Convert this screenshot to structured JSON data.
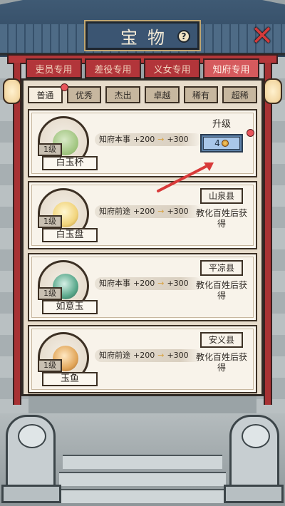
{
  "title": "宝物",
  "top_tabs": [
    {
      "label": "吏员专用",
      "active": false
    },
    {
      "label": "差役专用",
      "active": false
    },
    {
      "label": "义女专用",
      "active": false
    },
    {
      "label": "知府专用",
      "active": true
    }
  ],
  "sub_tabs": [
    {
      "label": "普通",
      "active": true
    },
    {
      "label": "优秀",
      "active": false
    },
    {
      "label": "杰出",
      "active": false
    },
    {
      "label": "卓越",
      "active": false
    },
    {
      "label": "稀有",
      "active": false
    },
    {
      "label": "超稀",
      "active": false
    }
  ],
  "items": [
    {
      "name": "白玉杯",
      "level": "1级",
      "stat_label": "知府本事",
      "stat_now": "+200",
      "stat_next": "+300",
      "icon": "jade-cup-icon",
      "action": "upgrade",
      "upgrade_title": "升级",
      "upgrade_cost": "4"
    },
    {
      "name": "白玉盘",
      "level": "1级",
      "stat_label": "知府前途",
      "stat_now": "+200",
      "stat_next": "+300",
      "icon": "jade-plate-icon",
      "action": "locked",
      "location": "山泉县",
      "hint": "教化百姓后获得"
    },
    {
      "name": "如意玉",
      "level": "1级",
      "stat_label": "知府本事",
      "stat_now": "+200",
      "stat_next": "+300",
      "icon": "ruyi-jade-icon",
      "action": "locked",
      "location": "平凉县",
      "hint": "教化百姓后获得"
    },
    {
      "name": "玉鱼",
      "level": "1级",
      "stat_label": "知府前途",
      "stat_now": "+200",
      "stat_next": "+300",
      "icon": "jade-fish-icon",
      "action": "locked",
      "location": "安义县",
      "hint": "教化百姓后获得"
    }
  ],
  "colors": {
    "accent_red": "#b5373a",
    "panel_bg": "#e7dccb",
    "button_blue": "#5b7fa6",
    "red_dot": "#e8545a"
  }
}
